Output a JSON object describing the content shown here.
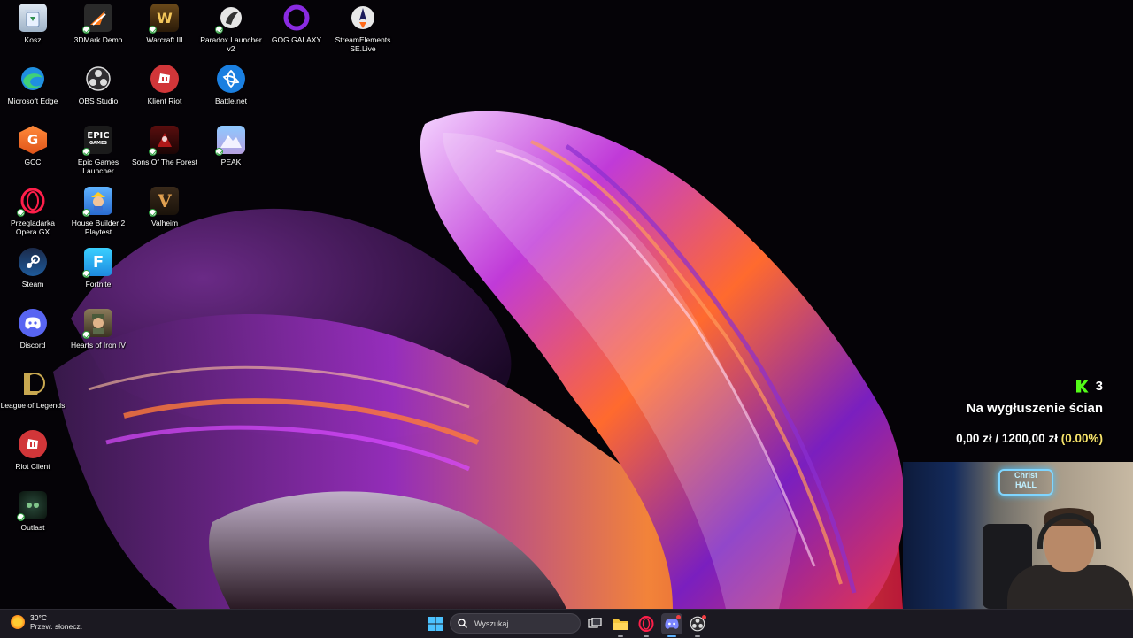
{
  "desktop": {
    "icons": [
      {
        "label": "Kosz"
      },
      {
        "label": "3DMark Demo"
      },
      {
        "label": "Warcraft III"
      },
      {
        "label": "Paradox Launcher v2"
      },
      {
        "label": "GOG GALAXY"
      },
      {
        "label": "StreamElements SE.Live"
      },
      {
        "label": "Microsoft Edge"
      },
      {
        "label": "OBS Studio"
      },
      {
        "label": "Klient Riot"
      },
      {
        "label": "Battle.net"
      },
      {
        "label": "GCC"
      },
      {
        "label": "Epic Games Launcher"
      },
      {
        "label": "Sons Of The Forest"
      },
      {
        "label": "PEAK"
      },
      {
        "label": "Przeglądarka Opera GX"
      },
      {
        "label": "House Builder 2 Playtest"
      },
      {
        "label": "Valheim"
      },
      {
        "label": "Steam"
      },
      {
        "label": "Fortnite"
      },
      {
        "label": "Discord"
      },
      {
        "label": "Hearts of Iron IV"
      },
      {
        "label": "League of Legends"
      },
      {
        "label": "Riot Client"
      },
      {
        "label": "Outlast"
      }
    ],
    "epic_icon_text": "EPIC",
    "epic_icon_subtext": "GAMES",
    "fortnite_icon_text": "F",
    "valheim_icon_text": "V"
  },
  "overlay": {
    "kick_count": "3",
    "goal_title": "Na wygłuszenie ścian",
    "goal_current": "0,00 zł",
    "goal_separator": "/",
    "goal_target": "1200,00 zł",
    "goal_percent": "(0.00%)",
    "progress_fraction": 0.0
  },
  "webcam": {
    "banner_line1": "Christ",
    "banner_line2": "HALL"
  },
  "taskbar": {
    "weather_temp": "30°C",
    "weather_condition": "Przew. słonecz.",
    "search_placeholder": "Wyszukaj",
    "apps": [
      {
        "icon": "windows-start-icon"
      },
      {
        "icon": "search-icon"
      },
      {
        "icon": "task-view-icon"
      },
      {
        "icon": "file-explorer-icon"
      },
      {
        "icon": "opera-gx-icon"
      },
      {
        "icon": "discord-icon"
      },
      {
        "icon": "obs-icon"
      }
    ]
  },
  "colors": {
    "accent": "#5fb3ff",
    "kick_green": "#53fc18",
    "percent_yellow": "#f7e36a",
    "taskbar_bg": "#1c1a22"
  }
}
